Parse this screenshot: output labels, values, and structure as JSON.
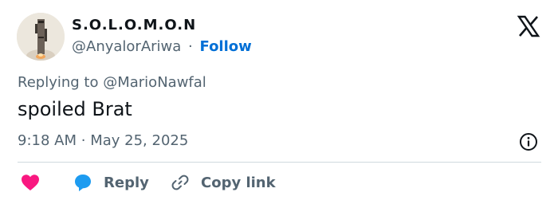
{
  "author": {
    "display_name": "S.O.L.O.M.O.N",
    "handle": "@AnyalorAriwa",
    "separator": "·",
    "follow_label": "Follow"
  },
  "tweet": {
    "replying_prefix": "Replying to",
    "replying_to": "@MarioNawfal",
    "text": "spoiled Brat",
    "time": "9:18 AM",
    "date_separator": "·",
    "date": "May 25, 2025"
  },
  "actions": {
    "like_icon": "heart-icon",
    "reply_label": "Reply",
    "reply_icon": "speech-bubble-icon",
    "copy_label": "Copy link",
    "copy_icon": "link-icon"
  },
  "colors": {
    "like": "#f91880",
    "reply": "#1d9bf0",
    "follow": "#006fd6",
    "muted": "#536471",
    "text": "#0f1419"
  }
}
